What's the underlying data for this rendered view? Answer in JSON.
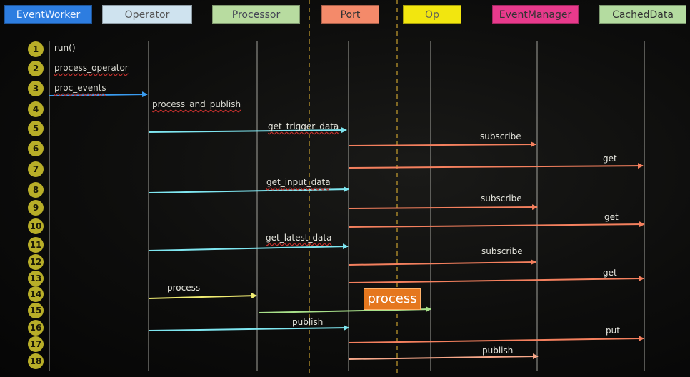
{
  "actors": [
    {
      "label": "EventWorker",
      "color": "#2d7de0",
      "text_color": "#eaf2ff"
    },
    {
      "label": "Operator",
      "color": "#cfe3ef",
      "text_color": "#555"
    },
    {
      "label": "Processor",
      "color": "#b8dca0",
      "text_color": "#445"
    },
    {
      "label": "Port",
      "color": "#f48a6a",
      "text_color": "#333"
    },
    {
      "label": "Op",
      "color": "#f2e60f",
      "text_color": "#665"
    },
    {
      "label": "EventManager",
      "color": "#e83a8c",
      "text_color": "#333"
    },
    {
      "label": "CachedData",
      "color": "#b4dca0",
      "text_color": "#333"
    }
  ],
  "steps": [
    "1",
    "2",
    "3",
    "4",
    "5",
    "6",
    "7",
    "8",
    "9",
    "10",
    "11",
    "12",
    "13",
    "14",
    "15",
    "16",
    "17",
    "18"
  ],
  "notes": {
    "run": "run()",
    "process_operator": "process_operator",
    "proc_events": "proc_events",
    "process_and_publish": "process_and_publish"
  },
  "messages": [
    {
      "label": "get_trigger_data",
      "color": "#7fe6f0"
    },
    {
      "label": "subscribe",
      "color": "#f4805e"
    },
    {
      "label": "get",
      "color": "#f4805e"
    },
    {
      "label": "get_input_data",
      "color": "#7fe6f0"
    },
    {
      "label": "subscribe",
      "color": "#f4805e"
    },
    {
      "label": "get",
      "color": "#f4805e"
    },
    {
      "label": "get_latest_data",
      "color": "#7fe6f0"
    },
    {
      "label": "subscribe",
      "color": "#f4805e"
    },
    {
      "label": "get",
      "color": "#f4805e"
    },
    {
      "label": "process",
      "color": "#f0ec72"
    },
    {
      "label": "",
      "color": "#a8e08a"
    },
    {
      "label": "publish",
      "color": "#7fe6f0"
    },
    {
      "label": "put",
      "color": "#f4805e"
    },
    {
      "label": "publish",
      "color": "#f7a88a"
    }
  ],
  "proc_events_arrow_color": "#3a9cf0",
  "process_badge": "process",
  "colors": {
    "divider": "#c8a030",
    "lifeline": "#c8c8c0"
  }
}
